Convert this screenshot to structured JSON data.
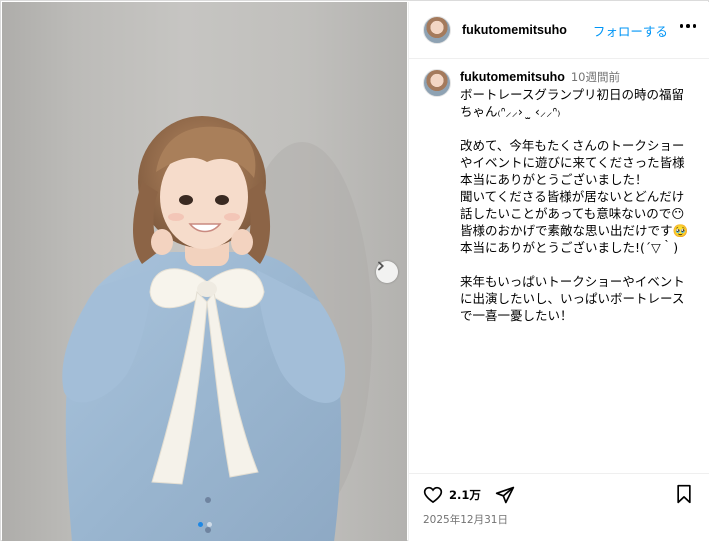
{
  "post": {
    "username": "fukutomemitsuho",
    "follow_label": "フォローする",
    "more_icon": "more-horizontal-icon"
  },
  "caption": {
    "username": "fukutomemitsuho",
    "time_ago": "10週間前",
    "lines": [
      "ボートレースグランプリ初日の時の福留",
      "ちゃん₍ᐢ⸝⸝›  ̫ ‹⸝⸝ᐢ₎",
      "",
      "改めて、今年もたくさんのトークショー",
      "やイベントに遊びに来てくださった皆様",
      "本当にありがとうございました！",
      "聞いてくださる皆様が居ないとどんだけ",
      "話したいことがあっても意味ないので😶",
      "皆様のおかげで素敵な思い出だけです🥹",
      "本当にありがとうございました!(´▽｀)",
      "",
      "来年もいっぱいトークショーやイベント",
      "に出演したいし、いっぱいボートレース",
      "で一喜一憂したい！"
    ]
  },
  "actions": {
    "likes": "2.1万",
    "like_icon": "heart-icon",
    "share_icon": "paper-plane-icon",
    "save_icon": "bookmark-icon"
  },
  "date": "2025年12月31日",
  "carousel": {
    "slide_count": 2,
    "active_slide": 1,
    "next_icon": "chevron-right-icon"
  }
}
